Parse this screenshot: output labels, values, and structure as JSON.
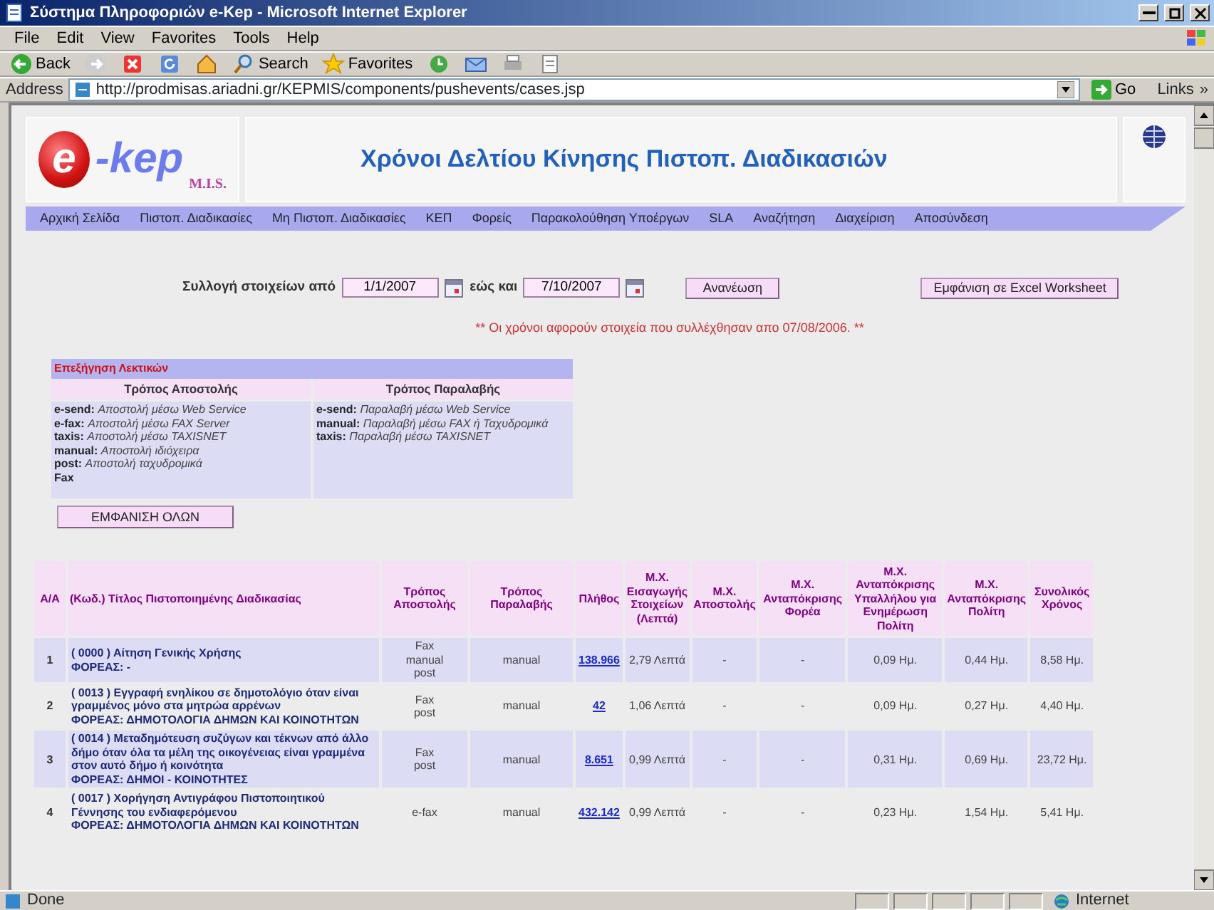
{
  "window": {
    "title": "Σύστημα Πληροφοριών e-Kep - Microsoft Internet Explorer"
  },
  "menu": [
    "File",
    "Edit",
    "View",
    "Favorites",
    "Tools",
    "Help"
  ],
  "toolbar": [
    {
      "kind": "back",
      "label": "Back"
    },
    {
      "kind": "forward"
    },
    {
      "kind": "stop"
    },
    {
      "kind": "refresh"
    },
    {
      "kind": "home"
    },
    {
      "kind": "search",
      "label": "Search"
    },
    {
      "kind": "favorites",
      "label": "Favorites"
    },
    {
      "kind": "history"
    },
    {
      "kind": "mail"
    },
    {
      "kind": "print"
    },
    {
      "kind": "edit"
    }
  ],
  "address": {
    "label": "Address",
    "url": "http://prodmisas.ariadni.gr/KEPMIS/components/pushevents/cases.jsp",
    "go": "Go",
    "links": "Links",
    "more": "»"
  },
  "page": {
    "logo_letter": "e",
    "logo_rest": "-kep",
    "logo_sub": "M.I.S.",
    "title": "Χρόνοι Δελτίου Κίνησης Πιστοπ. Διαδικασιών",
    "nav": [
      "Αρχική Σελίδα",
      "Πιστοπ. Διαδικασίες",
      "Μη Πιστοπ. Διαδικασίες",
      "ΚΕΠ",
      "Φορείς",
      "Παρακολούθηση Υποέργων",
      "SLA",
      "Αναζήτηση",
      "Διαχείριση",
      "Αποσύνδεση"
    ],
    "filter": {
      "from_label": "Συλλογή στοιχείων από",
      "from": "1/1/2007",
      "to_label": "εώς και",
      "to": "7/10/2007",
      "refresh": "Ανανέωση",
      "excel": "Εμφάνιση σε Excel Worksheet"
    },
    "note": "** Οι χρόνοι αφορούν στοιχεία που συλλέχθησαν απο 07/08/2006. **",
    "legend": {
      "title": "Επεξήγηση Λεκτικών",
      "columns": [
        {
          "heading": "Τρόπος Αποστολής",
          "entries": [
            {
              "term": "e-send:",
              "text": "Αποστολή μέσω Web Service"
            },
            {
              "term": "e-fax:",
              "text": "Αποστολή μέσω FAX Server"
            },
            {
              "term": "taxis:",
              "text": "Αποστολή μέσω TAXISNET"
            },
            {
              "term": "manual:",
              "text": "Αποστολή ιδιόχειρα"
            },
            {
              "term": "post:",
              "text": "Αποστολή ταχυδρομικά"
            },
            {
              "term": "Fax"
            }
          ]
        },
        {
          "heading": "Τρόπος Παραλαβής",
          "entries": [
            {
              "term": "e-send:",
              "text": "Παραλαβή μέσω Web Service"
            },
            {
              "term": "manual:",
              "text": "Παραλαβή μέσω FAX ή Ταχυδρομικά"
            },
            {
              "term": "taxis:",
              "text": "Παραλαβή μέσω TAXISNET"
            }
          ]
        }
      ]
    },
    "show_all": "ΕΜΦΑΝΙΣΗ ΟΛΩΝ",
    "table": {
      "columns": [
        "A/A",
        "(Κωδ.) Τίτλος Πιστοποιημένης Διαδικασίας",
        "Τρόπος Αποστολής",
        "Τρόπος Παραλαβής",
        "Πλήθος",
        "Μ.Χ. Εισαγωγής Στοιχείων (Λεπτά)",
        "Μ.Χ. Αποστολής",
        "Μ.Χ. Ανταπόκρισης Φορέα",
        "Μ.Χ. Ανταπόκρισης Υπαλλήλου για Ενημέρωση Πολίτη",
        "Μ.Χ. Ανταπόκρισης Πολίτη",
        "Συνολικός Χρόνος"
      ],
      "rows": [
        {
          "aa": "1",
          "title": "( 0000 ) Αίτηση Γενικής Χρήσης",
          "agency": "ΦΟΡΕΑΣ: -",
          "send": [
            "Fax",
            "manual",
            "post"
          ],
          "receive": "manual",
          "count": "138.966",
          "entry": "2,79 Λεπτά",
          "send_avg": "-",
          "agency_avg": "-",
          "employee_avg": "0,09 Ημ.",
          "citizen_avg": "0,44 Ημ.",
          "total": "8,58 Ημ."
        },
        {
          "aa": "2",
          "title": "( 0013 ) Εγγραφή ενηλίκου σε δημοτολόγιο όταν είναι γραμμένος μόνο στα μητρώα αρρένων",
          "agency": "ΦΟΡΕΑΣ: ΔΗΜΟΤΟΛΟΓΙΑ ΔΗΜΩΝ ΚΑΙ ΚΟΙΝΟΤΗΤΩΝ",
          "send": [
            "Fax",
            "post"
          ],
          "receive": "manual",
          "count": "42",
          "entry": "1,06 Λεπτά",
          "send_avg": "-",
          "agency_avg": "-",
          "employee_avg": "0,09 Ημ.",
          "citizen_avg": "0,27 Ημ.",
          "total": "4,40 Ημ."
        },
        {
          "aa": "3",
          "title": "( 0014 ) Μεταδημότευση συζύγων και τέκνων από άλλο δήμο όταν όλα τα μέλη της οικογένειας είναι γραμμένα στον αυτό δήμο ή κοινότητα",
          "agency": "ΦΟΡΕΑΣ: ΔΗΜΟΙ - ΚΟΙΝΟΤΗΤΕΣ",
          "send": [
            "Fax",
            "post"
          ],
          "receive": "manual",
          "count": "8.651",
          "entry": "0,99 Λεπτά",
          "send_avg": "-",
          "agency_avg": "-",
          "employee_avg": "0,31 Ημ.",
          "citizen_avg": "0,69 Ημ.",
          "total": "23,72 Ημ."
        },
        {
          "aa": "4",
          "title": "( 0017 ) Χορήγηση Αντιγράφου Πιστοποιητικού Γέννησης του ενδιαφερόμενου",
          "agency": "ΦΟΡΕΑΣ: ΔΗΜΟΤΟΛΟΓΙΑ ΔΗΜΩΝ ΚΑΙ ΚΟΙΝΟΤΗΤΩΝ",
          "send": [
            "e-fax"
          ],
          "receive": "manual",
          "count": "432.142",
          "entry": "0,99 Λεπτά",
          "send_avg": "-",
          "agency_avg": "-",
          "employee_avg": "0,23 Ημ.",
          "citizen_avg": "1,54 Ημ.",
          "total": "5,41 Ημ."
        }
      ]
    }
  },
  "status_bar": {
    "text": "Done",
    "zone": "Internet"
  }
}
